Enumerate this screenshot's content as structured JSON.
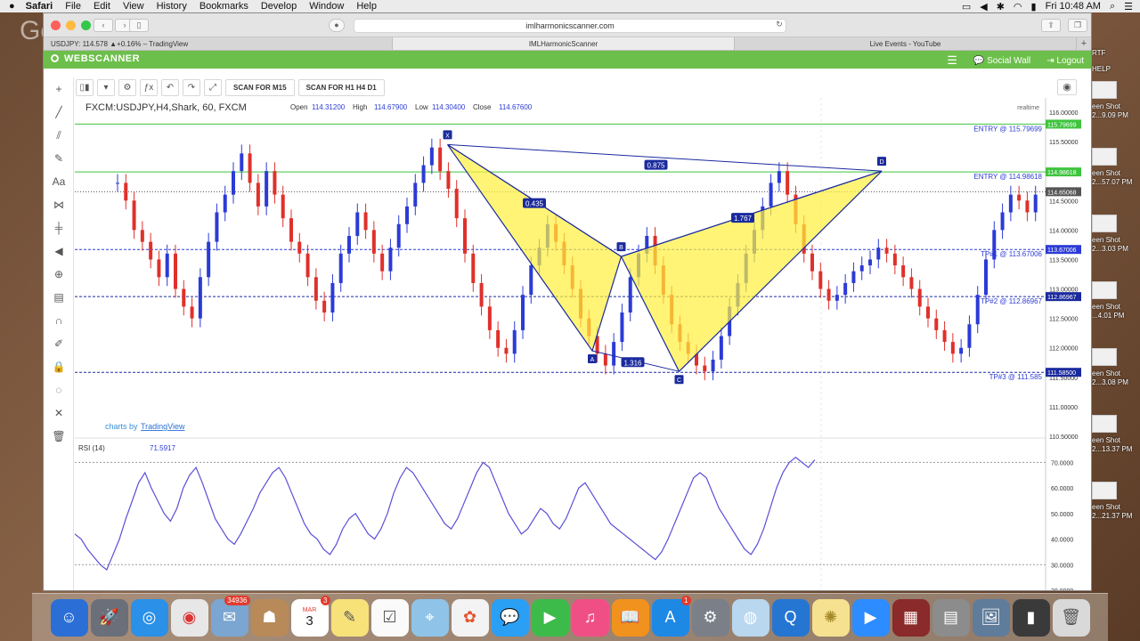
{
  "menubar": {
    "app_name": "Safari",
    "items": [
      "File",
      "Edit",
      "View",
      "History",
      "Bookmarks",
      "Develop",
      "Window",
      "Help"
    ],
    "clock": "Fri 10:48 AM",
    "status_icons": [
      "screen-icon",
      "volume-icon",
      "bluetooth-icon",
      "wifi-icon",
      "battery-icon",
      "search-icon",
      "list-icon"
    ]
  },
  "desktop": {
    "overlay_text": "Google"
  },
  "browser": {
    "address": "imlharmonicscanner.com",
    "tabs": [
      {
        "label": "USDJPY: 114.578 ▲+0.16% – TradingView"
      },
      {
        "label": "IMLHarmonicScanner"
      },
      {
        "label": "Live Events - YouTube"
      }
    ],
    "active_tab": 1
  },
  "site": {
    "brand": "WEBSCANNER",
    "social_wall": "Social Wall",
    "logout": "Logout"
  },
  "toolbar": {
    "scan_m15": "SCAN FOR M15",
    "scan_h1": "SCAN FOR H1 H4 D1"
  },
  "chart_header": {
    "symbol": "FXCM:USDJPY,H4,Shark, 60, FXCM",
    "open_label": "Open",
    "open": "114.31200",
    "high_label": "High",
    "high": "114.67900",
    "low_label": "Low",
    "low": "114.30400",
    "close_label": "Close",
    "close": "114.67600",
    "realtime": "realtime",
    "tv_credit_prefix": "charts by",
    "tv_credit": "TradingView",
    "rsi_label": "RSI (14)",
    "rsi_value": "71.5917"
  },
  "chart_data": {
    "type": "candlestick",
    "price_axis": [
      "116.00000",
      "115.50000",
      "115.00000",
      "114.50000",
      "114.00000",
      "113.50000",
      "113.00000",
      "112.50000",
      "112.00000",
      "111.50000",
      "111.00000",
      "110.50000"
    ],
    "price_ylim": [
      110.5,
      116.0
    ],
    "rsi_axis": [
      "70.0000",
      "60.0000",
      "50.0000",
      "40.0000",
      "30.0000",
      "20.0000"
    ],
    "rsi_ylim": [
      20,
      75
    ],
    "levels": [
      {
        "label": "ENTRY @ 115.79699",
        "tag": "115.79699",
        "price": 115.797,
        "color": "#3ec43e"
      },
      {
        "label": "ENTRY @ 114.98618",
        "tag": "114.98618",
        "price": 114.986,
        "color": "#3ec43e"
      },
      {
        "label": "TP#1 @ 113.67006",
        "tag": "113.67006",
        "price": 113.67,
        "color": "#2b3bd6"
      },
      {
        "label": "TP#2 @ 112.86967",
        "tag": "112.86967",
        "price": 112.87,
        "color": "#1a2a9e"
      },
      {
        "label": "TP#3 @ 111.585",
        "tag": "111.58500",
        "price": 111.585,
        "color": "#1a2a9e"
      }
    ],
    "last_price_tag": "114.65068",
    "last_price": 114.65,
    "pattern": {
      "points": [
        {
          "label": "X",
          "bar": 57,
          "price": 115.45
        },
        {
          "label": "A",
          "bar": 82,
          "price": 111.95
        },
        {
          "label": "B",
          "bar": 87,
          "price": 113.55
        },
        {
          "label": "C",
          "bar": 97,
          "price": 111.6
        },
        {
          "label": "D",
          "bar": 132,
          "price": 115.0
        }
      ],
      "ratios": [
        {
          "label": "0.875",
          "price": 115.1,
          "bar": 93
        },
        {
          "label": "0.435",
          "price": 114.45,
          "bar": 72
        },
        {
          "label": "1.767",
          "price": 114.2,
          "bar": 108
        },
        {
          "label": "1.316",
          "price": 111.75,
          "bar": 89
        }
      ]
    },
    "price_path": [
      114.8,
      114.5,
      114.0,
      113.8,
      113.5,
      113.2,
      113.6,
      113.0,
      112.7,
      112.5,
      113.2,
      113.8,
      114.3,
      114.6,
      115.0,
      115.3,
      114.8,
      114.4,
      115.0,
      114.6,
      114.2,
      113.8,
      113.6,
      113.2,
      112.8,
      112.6,
      113.1,
      113.6,
      113.9,
      114.3,
      114.0,
      113.6,
      113.3,
      113.7,
      114.1,
      114.4,
      114.8,
      115.1,
      115.4,
      115.0,
      114.7,
      114.2,
      113.6,
      113.1,
      112.7,
      112.3,
      112.0,
      111.9,
      112.3,
      112.9,
      113.4,
      113.7,
      114.1,
      113.8,
      113.4,
      113.0,
      112.5,
      112.2,
      111.9,
      111.7,
      112.1,
      112.6,
      113.2,
      113.6,
      113.9,
      113.4,
      112.9,
      112.4,
      112.1,
      111.9,
      111.7,
      111.6,
      111.8,
      112.2,
      112.7,
      113.1,
      113.6,
      114.0,
      114.4,
      114.8,
      115.0,
      114.6,
      114.1,
      113.6,
      113.3,
      113.0,
      112.8,
      112.9,
      113.1,
      113.3,
      113.4,
      113.5,
      113.7,
      113.6,
      113.4,
      113.2,
      113.0,
      112.7,
      112.5,
      112.3,
      112.1,
      111.9,
      112.0,
      112.4,
      112.9,
      113.5,
      114.0,
      114.3,
      114.6,
      114.5,
      114.3,
      114.6
    ],
    "rsi_path": [
      42,
      40,
      36,
      33,
      30,
      28,
      34,
      40,
      48,
      55,
      62,
      66,
      60,
      55,
      50,
      47,
      52,
      60,
      65,
      68,
      62,
      55,
      48,
      44,
      40,
      38,
      42,
      47,
      52,
      58,
      62,
      66,
      68,
      64,
      58,
      52,
      46,
      42,
      40,
      36,
      34,
      38,
      44,
      48,
      50,
      46,
      42,
      40,
      44,
      50,
      58,
      64,
      68,
      66,
      62,
      58,
      54,
      50,
      46,
      44,
      48,
      54,
      60,
      66,
      70,
      68,
      62,
      56,
      50,
      46,
      42,
      44,
      48,
      52,
      50,
      46,
      44,
      48,
      54,
      60,
      62,
      58,
      54,
      50,
      46,
      44,
      42,
      40,
      38,
      36,
      34,
      32,
      35,
      40,
      46,
      52,
      58,
      64,
      66,
      64,
      58,
      52,
      48,
      44,
      40,
      36,
      34,
      38,
      44,
      52,
      60,
      66,
      70,
      72,
      70,
      68,
      71
    ]
  },
  "dock": {
    "badges": {
      "mail": "34936",
      "calendar": "3",
      "appstore": "1"
    },
    "calendar_day": "3",
    "calendar_month": "MAR"
  },
  "desktop_files": [
    {
      "label": "RTF"
    },
    {
      "label": "HELP"
    },
    {
      "label": "een Shot\n2...9.09 PM"
    },
    {
      "label": "een Shot\n2...57.07 PM"
    },
    {
      "label": "een Shot\n2...3.03 PM"
    },
    {
      "label": "een Shot\n...4.01 PM"
    },
    {
      "label": "een Shot\n2...3.08 PM"
    },
    {
      "label": "een Shot\n2...13.37 PM"
    },
    {
      "label": "een Shot\n2...21.37 PM"
    }
  ]
}
